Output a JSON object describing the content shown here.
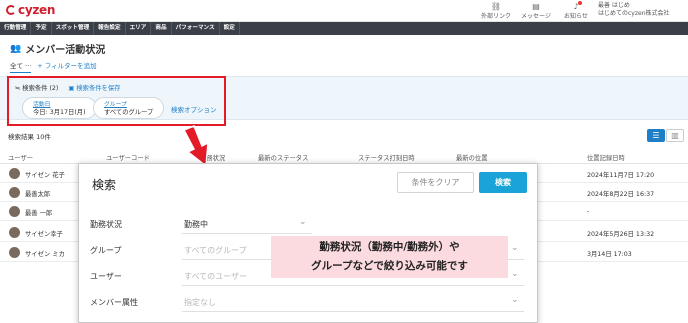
{
  "app": {
    "logo_text": "cyzen",
    "brand_color": "#d0202e",
    "accent_color": "#1e7fc7"
  },
  "header": {
    "items": [
      {
        "label": "外部リンク",
        "icon": "link-icon"
      },
      {
        "label": "メッセージ",
        "icon": "message-icon"
      },
      {
        "label": "お知らせ",
        "icon": "bell-icon"
      }
    ],
    "user": {
      "name": "最善 はじめ",
      "company": "はじめてのcyzen株式会社"
    }
  },
  "nav": {
    "items": [
      "行動管理",
      "予定",
      "スポット管理",
      "報告設定",
      "エリア",
      "商品",
      "パフォーマンス",
      "設定"
    ]
  },
  "page": {
    "title": "メンバー活動状況",
    "filter_tab": "全て ···",
    "add_filter": "+ フィルターを追加"
  },
  "search_bar": {
    "conditions": "≒ 検索条件 (2)",
    "save": "検索条件を保存",
    "date_label": "活動日",
    "date_value": "今日: 3月17日(月)",
    "group_label": "グループ",
    "group_value": "すべてのグループ",
    "options": "検索オプション"
  },
  "results": {
    "count": "検索結果 10件"
  },
  "table": {
    "headers": [
      "ユーザー",
      "ユーザーコード",
      "勤務状況",
      "最新のステータス",
      "ステータス打刻日時",
      "最新の位置",
      "位置記録日時"
    ],
    "rows": [
      {
        "name": "サイゼン 花子",
        "time": "2024年11月7日 17:20"
      },
      {
        "name": "最善太郎",
        "time": "2024年8月22日 16:37"
      },
      {
        "name": "最善 一郎",
        "time": "-"
      },
      {
        "name": "サイゼン幸子",
        "time": "2024年5月26日 13:32"
      },
      {
        "name": "サイゼン ミカ",
        "time": "3月14日 17:03"
      }
    ]
  },
  "modal": {
    "title": "検索",
    "clear_button": "条件をクリア",
    "search_button": "検索",
    "fields": [
      {
        "label": "勤務状況",
        "value": "勤務中",
        "placeholder": false
      },
      {
        "label": "グループ",
        "value": "すべてのグループ",
        "placeholder": true
      },
      {
        "label": "ユーザー",
        "value": "すべてのユーザー",
        "placeholder": true
      },
      {
        "label": "メンバー属性",
        "value": "指定なし",
        "placeholder": true
      }
    ]
  },
  "callout": {
    "line1": "勤務状況（勤務中/勤務外）や",
    "line2": "グループなどで絞り込み可能です"
  }
}
